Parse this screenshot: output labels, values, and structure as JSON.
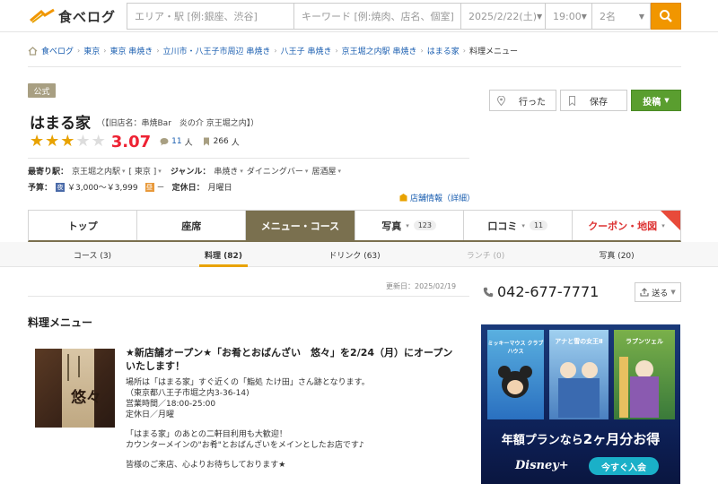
{
  "header": {
    "logo_text": "食べログ",
    "search": {
      "area_placeholder": "エリア・駅 [例:銀座、渋谷]",
      "keyword_placeholder": "キーワード [例:焼肉、店名、個室]",
      "date": "2025/2/22(土)",
      "time": "19:00",
      "people": "2名"
    }
  },
  "breadcrumb": {
    "items": [
      "食べログ",
      "東京",
      "東京 串焼き",
      "立川市・八王子市周辺 串焼き",
      "八王子 串焼き",
      "京王堀之内駅 串焼き",
      "はまる家"
    ],
    "current": "料理メニュー"
  },
  "store": {
    "official_badge": "公式",
    "name": "はまる家",
    "old_name": "（【旧店名：串焼Bar　炎の介 京王堀之内】）",
    "rating": 3.07,
    "rating_text": "3.07",
    "stars_filled": 3,
    "reviews_count": "11",
    "reviews_unit": "人",
    "saves_count": "266",
    "saves_unit": "人",
    "nearest_label": "最寄り駅：",
    "nearest_value": "京王堀之内駅",
    "area_value": "[ 東京 ]",
    "genre_label": "ジャンル：",
    "genres": [
      "串焼き",
      "ダイニングバー",
      "居酒屋"
    ],
    "budget_label": "予算：",
    "budget_night_icon": "夜",
    "budget_night": "￥3,000～￥3,999",
    "budget_day_icon": "昼",
    "budget_day": "－",
    "holiday_label": "定休日：",
    "holiday_value": "月曜日",
    "store_info_link": "店舗情報（詳細）"
  },
  "actions": {
    "went": "行った",
    "save": "保存",
    "post": "投稿"
  },
  "main_tabs": [
    {
      "label": "トップ"
    },
    {
      "label": "座席"
    },
    {
      "label": "メニュー・コース"
    },
    {
      "label": "写真",
      "count": "123"
    },
    {
      "label": "口コミ",
      "count": "11"
    },
    {
      "label": "クーポン・地図"
    }
  ],
  "sub_tabs": [
    {
      "label": "コース (3)"
    },
    {
      "label": "料理 (82)"
    },
    {
      "label": "ドリンク (63)"
    },
    {
      "label": "ランチ (0)"
    },
    {
      "label": "写真 (20)"
    }
  ],
  "content": {
    "updated": "更新日：2025/02/19",
    "section_title": "料理メニュー",
    "news_title": "★新店舗オープン★「お肴とおばんざい　悠々」を2/24（月）にオープンいたします！",
    "news_lines": [
      "場所は「はまる家」すぐ近くの「鮨処 たけ田」さん跡となります。",
      "（東京都八王子市堀之内3-36-14)",
      "営業時間／18:00-25:00",
      "定休日／月曜",
      "",
      "「はまる家」のあとの二軒目利用も大歓迎！",
      "カウンターメインの\"お肴\"とおばんざいをメインとしたお店です♪",
      "",
      "皆様のご来店、心よりお待ちしております★"
    ],
    "image_sign_text": "悠々"
  },
  "sidebar": {
    "phone": "042-677-7771",
    "send": "送る",
    "ad": {
      "poster1": "ミッキーマウス クラブハウス",
      "poster2": "アナと雪の女王Ⅱ",
      "poster3": "ラプンツェル",
      "copy_pre": "年額プランなら",
      "copy_big": "2ヶ月分お得",
      "logo": "Disney+",
      "cta": "今すぐ入会"
    }
  },
  "colors": {
    "accent": "#f19600",
    "active_tab": "#7a704f",
    "score_red": "#ee2233",
    "link": "#1a5eb0",
    "post_green": "#5a9e2f"
  }
}
